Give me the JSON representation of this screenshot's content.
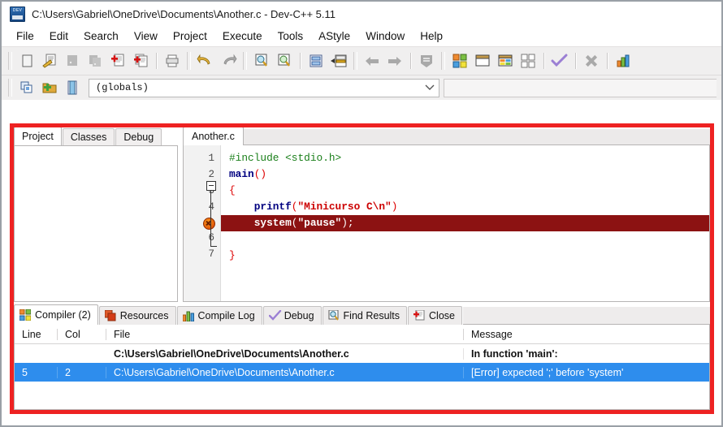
{
  "window": {
    "title": "C:\\Users\\Gabriel\\OneDrive\\Documents\\Another.c - Dev-C++ 5.11",
    "app_icon": "dev-cpp-icon"
  },
  "menubar": {
    "items": [
      {
        "label": "File"
      },
      {
        "label": "Edit"
      },
      {
        "label": "Search"
      },
      {
        "label": "View"
      },
      {
        "label": "Project"
      },
      {
        "label": "Execute"
      },
      {
        "label": "Tools"
      },
      {
        "label": "AStyle"
      },
      {
        "label": "Window"
      },
      {
        "label": "Help"
      }
    ]
  },
  "toolbar": {
    "buttons": [
      {
        "name": "new-file-icon"
      },
      {
        "name": "open-file-icon"
      },
      {
        "name": "save-file-icon"
      },
      {
        "name": "save-all-icon"
      },
      {
        "name": "close-file-icon"
      },
      {
        "name": "close-all-icon"
      },
      {
        "name": "print-icon"
      },
      {
        "name": "undo-icon"
      },
      {
        "name": "redo-icon"
      },
      {
        "name": "find-icon"
      },
      {
        "name": "replace-icon"
      },
      {
        "name": "goto-line-icon"
      },
      {
        "name": "goto-function-icon"
      },
      {
        "name": "back-icon"
      },
      {
        "name": "forward-icon"
      },
      {
        "name": "toggle-bookmark-icon"
      },
      {
        "name": "compile-icon"
      },
      {
        "name": "run-icon"
      },
      {
        "name": "compile-run-icon"
      },
      {
        "name": "rebuild-all-icon"
      },
      {
        "name": "syntax-check-icon"
      },
      {
        "name": "stop-execution-icon"
      },
      {
        "name": "profile-icon"
      }
    ],
    "row2_buttons": [
      {
        "name": "new-project-icon"
      },
      {
        "name": "add-to-project-icon"
      },
      {
        "name": "project-options-icon"
      }
    ],
    "scope_combo": {
      "value": "(globals)",
      "arrow": "chevron-down-icon"
    }
  },
  "left_panel": {
    "tabs": [
      {
        "label": "Project",
        "active": true
      },
      {
        "label": "Classes",
        "active": false
      },
      {
        "label": "Debug",
        "active": false
      }
    ]
  },
  "editor": {
    "tabs": [
      {
        "label": "Another.c",
        "active": true
      }
    ],
    "lines": [
      {
        "num": "1",
        "marker": "none",
        "highlight": false,
        "tokens": [
          {
            "t": "#include ",
            "c": "pp"
          },
          {
            "t": "<stdio.h>",
            "c": "pp"
          }
        ]
      },
      {
        "num": "2",
        "marker": "none",
        "highlight": false,
        "tokens": [
          {
            "t": "main",
            "c": "kw"
          },
          {
            "t": "()",
            "c": "punc"
          }
        ]
      },
      {
        "num": "3",
        "marker": "fold",
        "highlight": false,
        "tokens": [
          {
            "t": "{",
            "c": "punc"
          }
        ]
      },
      {
        "num": "4",
        "marker": "none",
        "highlight": false,
        "tokens": [
          {
            "t": "    printf",
            "c": "fn"
          },
          {
            "t": "(",
            "c": "punc"
          },
          {
            "t": "\"Minicurso C\\n\"",
            "c": "str"
          },
          {
            "t": ")",
            "c": "punc"
          }
        ]
      },
      {
        "num": "5",
        "marker": "error",
        "highlight": true,
        "tokens": [
          {
            "t": "    system",
            "c": "fn"
          },
          {
            "t": "(",
            "c": "punc"
          },
          {
            "t": "\"pause\"",
            "c": "str"
          },
          {
            "t": ");",
            "c": "punc"
          }
        ]
      },
      {
        "num": "6",
        "marker": "none",
        "highlight": false,
        "tokens": []
      },
      {
        "num": "7",
        "marker": "none",
        "highlight": false,
        "tokens": [
          {
            "t": "}",
            "c": "punc"
          }
        ]
      }
    ]
  },
  "bottom_panel": {
    "tabs": [
      {
        "label": "Compiler (2)",
        "icon": "compiler-icon",
        "active": true
      },
      {
        "label": "Resources",
        "icon": "resources-icon",
        "active": false
      },
      {
        "label": "Compile Log",
        "icon": "compile-log-icon",
        "active": false
      },
      {
        "label": "Debug",
        "icon": "debug-check-icon",
        "active": false
      },
      {
        "label": "Find Results",
        "icon": "find-results-icon",
        "active": false
      },
      {
        "label": "Close",
        "icon": "close-panel-icon",
        "active": false
      }
    ],
    "columns": [
      "Line",
      "Col",
      "File",
      "Message"
    ],
    "rows": [
      {
        "line": "",
        "col": "",
        "file": "C:\\Users\\Gabriel\\OneDrive\\Documents\\Another.c",
        "message": "In function 'main':",
        "style": "bold",
        "selected": false
      },
      {
        "line": "5",
        "col": "2",
        "file": "C:\\Users\\Gabriel\\OneDrive\\Documents\\Another.c",
        "message": "[Error] expected ';' before 'system'",
        "style": "normal",
        "selected": true
      }
    ]
  },
  "annotations": {
    "highlight_frame_color": "#ee2222"
  }
}
